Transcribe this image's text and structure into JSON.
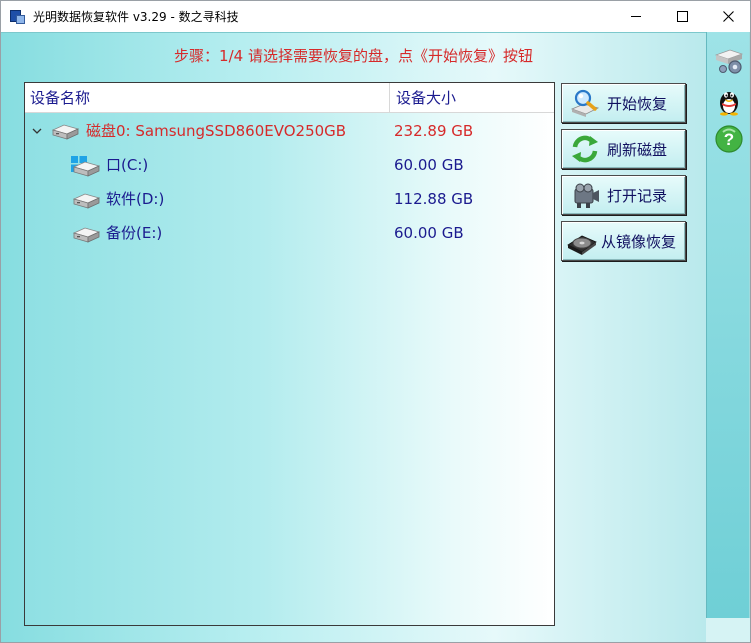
{
  "window": {
    "title": "光明数据恢复软件 v3.29 - 数之寻科技"
  },
  "step_text": "步骤：1/4 请选择需要恢复的盘，点《开始恢复》按钮",
  "tree": {
    "columns": [
      "设备名称",
      "设备大小"
    ],
    "rows": [
      {
        "name": "磁盘0: SamsungSSD860EVO250GB",
        "size": "232.89 GB",
        "type": "disk",
        "icon": "hard-disk-icon"
      },
      {
        "name": "口(C:)",
        "size": "60.00 GB",
        "type": "partition",
        "icon": "windows-logo-icon"
      },
      {
        "name": "软件(D:)",
        "size": "112.88 GB",
        "type": "partition",
        "icon": "hard-disk-icon"
      },
      {
        "name": "备份(E:)",
        "size": "60.00 GB",
        "type": "partition",
        "icon": "hard-disk-icon"
      }
    ]
  },
  "buttons": {
    "start_recovery": "开始恢复",
    "refresh_disks": "刷新磁盘",
    "open_record": "打开记录",
    "restore_from_image": "从镜像恢复"
  },
  "colors": {
    "step_text": "#d62a2a",
    "disk_row": "#d62a2a",
    "partition_row": "#1b1b8f",
    "client_bg_left": "#86dde0",
    "client_bg_right": "#e6f9fa"
  },
  "side_icons": [
    "settings-icon",
    "qq-penguin-icon",
    "help-icon"
  ]
}
